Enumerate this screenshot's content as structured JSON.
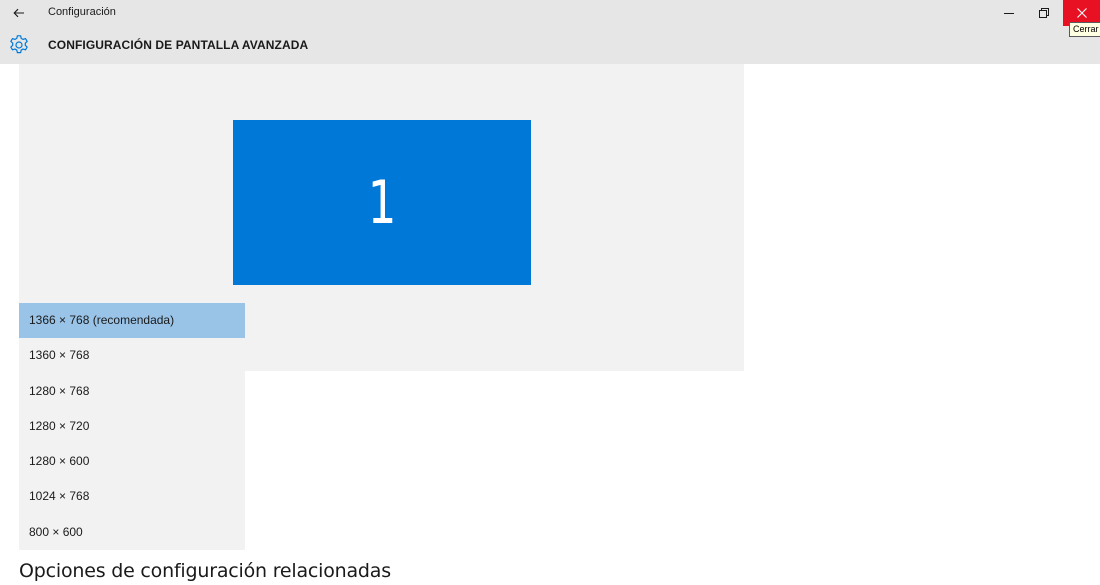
{
  "window": {
    "title": "Configuración",
    "close_tooltip": "Cerrar"
  },
  "header": {
    "title": "CONFIGURACIÓN DE PANTALLA AVANZADA"
  },
  "display": {
    "monitor_number": "1",
    "monitor_color": "#0078d7"
  },
  "resolution_dropdown": {
    "selected_index": 0,
    "options": [
      "1366 × 768 (recomendada)",
      "1360 × 768",
      "1280 × 768",
      "1280 × 720",
      "1280 × 600",
      "1024 × 768",
      "800 × 600"
    ]
  },
  "related": {
    "heading": "Opciones de configuración relacionadas"
  },
  "colors": {
    "accent": "#0078d7",
    "selected_option": "#99c4e8",
    "close_button": "#e81123"
  },
  "icons": {
    "back": "back-arrow-icon",
    "settings": "gear-icon",
    "minimize": "minimize-icon",
    "restore": "restore-icon",
    "close": "close-icon"
  }
}
